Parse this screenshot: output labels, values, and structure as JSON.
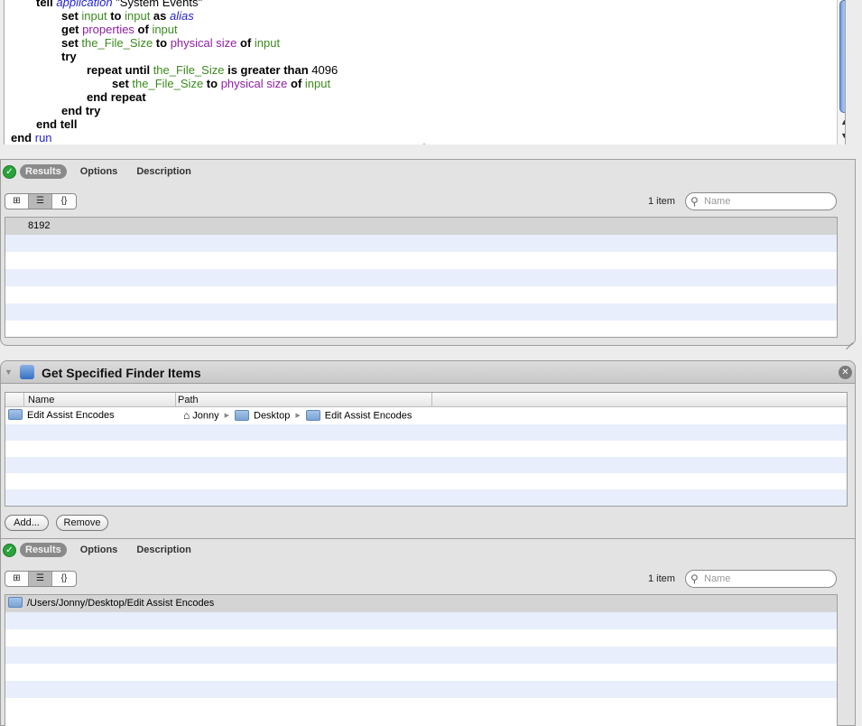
{
  "code": {
    "lines": [
      {
        "indent": 35,
        "parts": [
          {
            "t": "tell ",
            "c": "kw"
          },
          {
            "t": "application",
            "c": "cls"
          },
          {
            "t": " \"System Events\"",
            "c": "str"
          }
        ]
      },
      {
        "indent": 63,
        "parts": [
          {
            "t": "set ",
            "c": "kw"
          },
          {
            "t": "input",
            "c": "var"
          },
          {
            "t": " to ",
            "c": "kw"
          },
          {
            "t": "input",
            "c": "var"
          },
          {
            "t": " as ",
            "c": "kw"
          },
          {
            "t": "alias",
            "c": "cls"
          }
        ]
      },
      {
        "indent": 63,
        "parts": [
          {
            "t": "get ",
            "c": "kw"
          },
          {
            "t": "properties",
            "c": "prop"
          },
          {
            "t": " of ",
            "c": "kw"
          },
          {
            "t": "input",
            "c": "var"
          }
        ]
      },
      {
        "indent": 63,
        "parts": [
          {
            "t": "set ",
            "c": "kw"
          },
          {
            "t": "the_File_Size",
            "c": "var"
          },
          {
            "t": " to ",
            "c": "kw"
          },
          {
            "t": "physical size",
            "c": "prop"
          },
          {
            "t": " of ",
            "c": "kw"
          },
          {
            "t": "input",
            "c": "var"
          }
        ]
      },
      {
        "indent": 63,
        "parts": [
          {
            "t": "try",
            "c": "kw"
          }
        ]
      },
      {
        "indent": 91,
        "parts": [
          {
            "t": "repeat until ",
            "c": "kw"
          },
          {
            "t": "the_File_Size",
            "c": "var"
          },
          {
            "t": " is greater than ",
            "c": "kw"
          },
          {
            "t": "4096",
            "c": "num"
          }
        ]
      },
      {
        "indent": 119,
        "parts": [
          {
            "t": "set ",
            "c": "kw"
          },
          {
            "t": "the_File_Size",
            "c": "var"
          },
          {
            "t": " to ",
            "c": "kw"
          },
          {
            "t": "physical size",
            "c": "prop"
          },
          {
            "t": " of ",
            "c": "kw"
          },
          {
            "t": "input",
            "c": "var"
          }
        ]
      },
      {
        "indent": 91,
        "parts": [
          {
            "t": "end repeat",
            "c": "kw"
          }
        ]
      },
      {
        "indent": 63,
        "parts": [
          {
            "t": "end try",
            "c": "kw"
          }
        ]
      },
      {
        "indent": 35,
        "parts": [
          {
            "t": "end tell",
            "c": "kw"
          }
        ]
      },
      {
        "indent": 7,
        "parts": [
          {
            "t": "end ",
            "c": "kw"
          },
          {
            "t": "run",
            "c": "sub"
          }
        ]
      }
    ]
  },
  "scroll_arrows": {
    "up": "▲",
    "down": "▼"
  },
  "resize_glyph": "ˆ",
  "results1": {
    "check_glyph": "✓",
    "tabs": {
      "results": "Results",
      "options": "Options",
      "description": "Description"
    },
    "view_icons": {
      "icon": "⊞",
      "list": "☰",
      "code": "{}"
    },
    "count": "1 item",
    "search_placeholder": "Name",
    "search_glyph": "⚲",
    "rows": [
      "8192"
    ]
  },
  "finder": {
    "collapse_glyph": "▼",
    "title": "Get Specified Finder Items",
    "close_glyph": "✕",
    "columns": {
      "name": "Name",
      "path": "Path"
    },
    "item": {
      "name": "Edit Assist Encodes",
      "home_glyph": "⌂",
      "path": [
        "Jonny",
        "Desktop",
        "Edit Assist Encodes"
      ],
      "sep_glyph": "▶"
    },
    "add_label": "Add...",
    "remove_label": "Remove"
  },
  "results2": {
    "check_glyph": "✓",
    "tabs": {
      "results": "Results",
      "options": "Options",
      "description": "Description"
    },
    "view_icons": {
      "icon": "⊞",
      "list": "☰",
      "code": "{}"
    },
    "count": "1 item",
    "search_placeholder": "Name",
    "search_glyph": "⚲",
    "rows": [
      "/Users/Jonny/Desktop/Edit Assist Encodes"
    ]
  }
}
